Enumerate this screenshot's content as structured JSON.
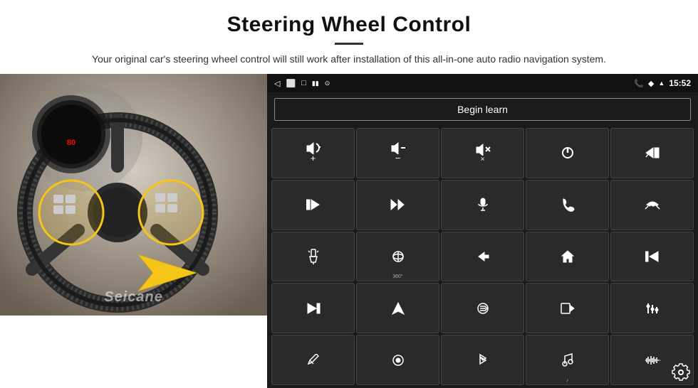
{
  "header": {
    "title": "Steering Wheel Control",
    "subtitle": "Your original car's steering wheel control will still work after installation of this all-in-one auto radio navigation system."
  },
  "status_bar": {
    "time": "15:52",
    "icons": [
      "back",
      "home",
      "recent",
      "signal_bars",
      "wifi",
      "location",
      "phone",
      "signal"
    ]
  },
  "begin_learn": {
    "label": "Begin learn"
  },
  "grid_buttons": [
    {
      "id": "vol_up",
      "icon": "vol_up"
    },
    {
      "id": "vol_down",
      "icon": "vol_down"
    },
    {
      "id": "vol_mute",
      "icon": "vol_mute"
    },
    {
      "id": "power",
      "icon": "power"
    },
    {
      "id": "prev_track_phone",
      "icon": "prev_track_phone"
    },
    {
      "id": "next",
      "icon": "next"
    },
    {
      "id": "pause",
      "icon": "pause"
    },
    {
      "id": "mic",
      "icon": "mic"
    },
    {
      "id": "phone",
      "icon": "phone"
    },
    {
      "id": "end_call",
      "icon": "end_call"
    },
    {
      "id": "flashlight",
      "icon": "flashlight"
    },
    {
      "id": "view360",
      "icon": "view360"
    },
    {
      "id": "back_nav",
      "icon": "back_nav"
    },
    {
      "id": "home_nav",
      "icon": "home_nav"
    },
    {
      "id": "skip_back",
      "icon": "skip_back"
    },
    {
      "id": "skip_forward",
      "icon": "skip_forward"
    },
    {
      "id": "navigate",
      "icon": "navigate"
    },
    {
      "id": "switch_source",
      "icon": "switch_source"
    },
    {
      "id": "record",
      "icon": "record"
    },
    {
      "id": "eq",
      "icon": "eq"
    },
    {
      "id": "pen",
      "icon": "pen"
    },
    {
      "id": "settings_circle",
      "icon": "settings_circle"
    },
    {
      "id": "bluetooth",
      "icon": "bluetooth"
    },
    {
      "id": "music",
      "icon": "music"
    },
    {
      "id": "waveform",
      "icon": "waveform"
    }
  ],
  "watermark": "Seicane"
}
